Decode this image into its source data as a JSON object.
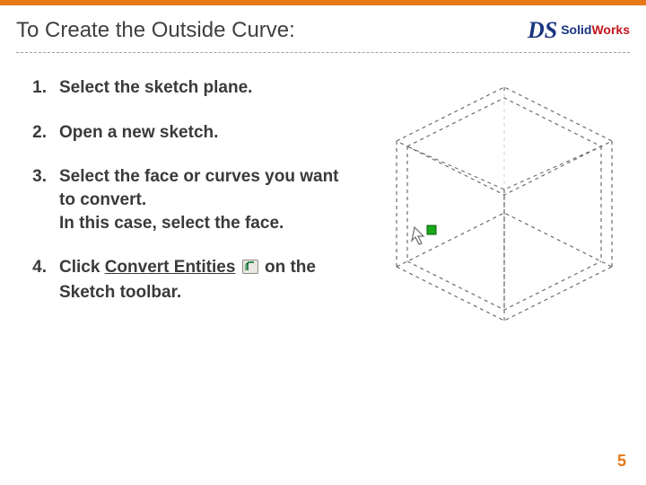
{
  "title": "To Create the Outside Curve:",
  "brand": {
    "logo": "DS",
    "word1": "Solid",
    "word2": "Works"
  },
  "steps": [
    {
      "text": "Select the sketch plane."
    },
    {
      "text": "Open a new sketch."
    },
    {
      "text": "Select the face or curves you want to convert.\nIn this case, select the face."
    },
    {
      "prefix": "Click ",
      "underlined": "Convert Entities",
      "suffix_after_icon": "on the Sketch toolbar.",
      "icon": "convert-entities-icon"
    }
  ],
  "page_number": "5"
}
